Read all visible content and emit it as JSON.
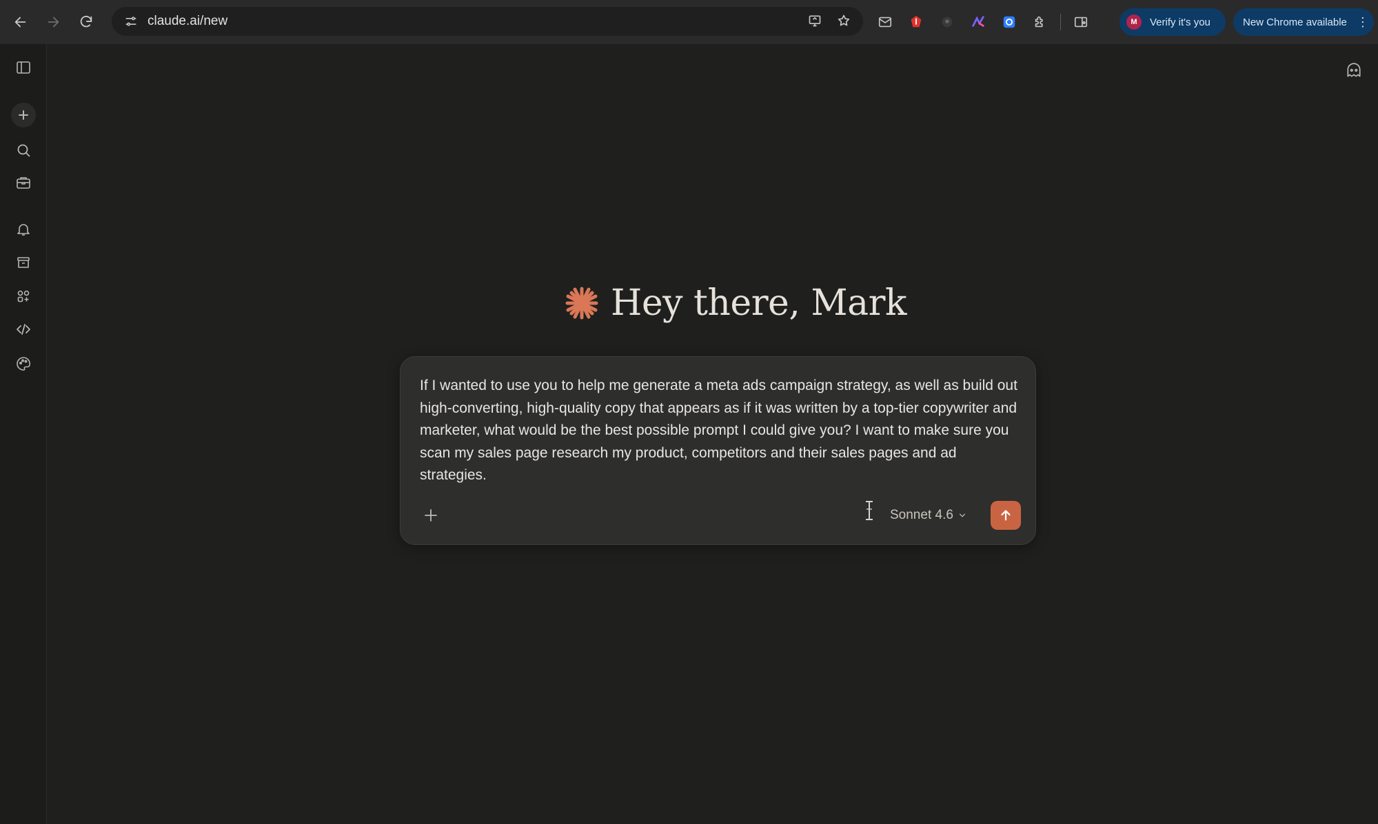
{
  "browser": {
    "url": "claude.ai/new",
    "verify_label": "Verify it's you",
    "verify_avatar_initial": "M",
    "update_label": "New Chrome available",
    "kebab": "⋮"
  },
  "main": {
    "greeting": "Hey there, Mark",
    "prompt": "If I wanted to use you to help me generate a meta ads campaign strategy, as well as build out high-converting, high-quality copy that appears as if it was written by a top-tier copywriter and marketer, what would be the best possible prompt I could give you? I want to make sure you scan my sales page research my product, competitors and their sales pages and ad strategies.",
    "model": "Sonnet 4.6"
  },
  "colors": {
    "accent": "#c96442",
    "background": "#1f1f1e",
    "composer": "#2e2e2c",
    "chrome_pill": "#0d3b66"
  },
  "icons": {
    "sidebar": [
      "sidebar-toggle-icon",
      "new-chat-icon",
      "search-icon",
      "briefcase-icon",
      "bell-icon",
      "archive-icon",
      "apps-icon",
      "code-icon",
      "palette-icon"
    ]
  }
}
